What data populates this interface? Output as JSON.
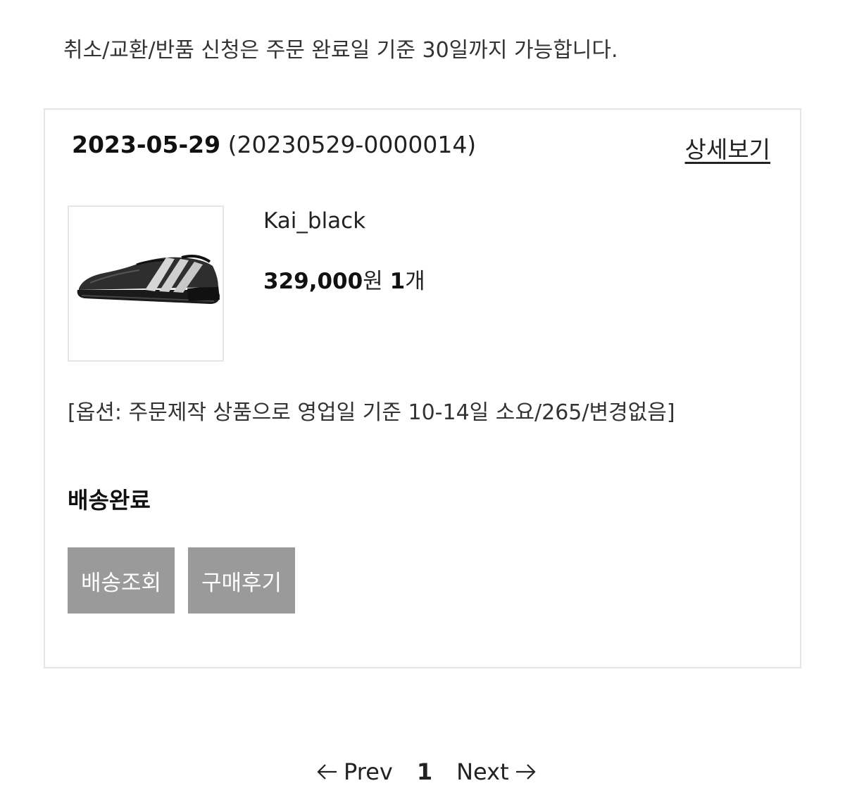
{
  "notice": "취소/교환/반품 신청은 주문 완료일 기준 30일까지 가능합니다.",
  "order": {
    "date": "2023-05-29",
    "number": "(20230529-0000014)",
    "detail_link": "상세보기",
    "product": {
      "name": "Kai_black",
      "price": "329,000",
      "currency": "원",
      "quantity": "1",
      "quantity_unit": "개",
      "image_icon": "shoe-image"
    },
    "options": "[옵션: 주문제작 상품으로 영업일 기준 10-14일 소요/265/변경없음]",
    "status": "배송완료",
    "buttons": {
      "track": "배송조회",
      "review": "구매후기"
    }
  },
  "pagination": {
    "prev": "Prev",
    "current_page": "1",
    "next": "Next"
  },
  "colors": {
    "button_bg": "#9a9a9a",
    "border": "#e6e6e6"
  }
}
